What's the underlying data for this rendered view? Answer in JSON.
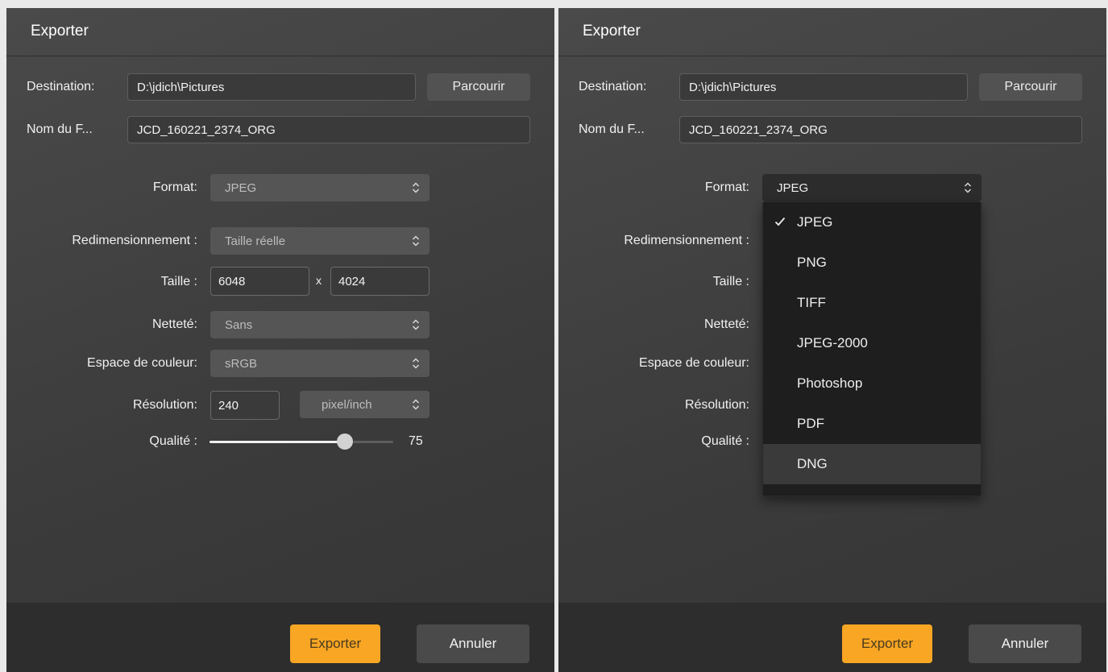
{
  "left_dialog": {
    "title": "Exporter",
    "destination_label": "Destination:",
    "destination_value": "D:\\jdich\\Pictures",
    "browse_label": "Parcourir",
    "filename_label": "Nom du F...",
    "filename_value": "JCD_160221_2374_ORG",
    "format_label": "Format:",
    "format_value": "JPEG",
    "resize_label": "Redimensionnement :",
    "resize_value": "Taille réelle",
    "size_label": "Taille :",
    "width_value": "6048",
    "times_sign": "x",
    "height_value": "4024",
    "sharpness_label": "Netteté:",
    "sharpness_value": "Sans",
    "colorspace_label": "Espace de couleur:",
    "colorspace_value": "sRGB",
    "resolution_label": "Résolution:",
    "resolution_value": "240",
    "resolution_unit": "pixel/inch",
    "quality_label": "Qualité :",
    "quality_value": "75",
    "quality_fraction": 0.75,
    "export_label": "Exporter",
    "cancel_label": "Annuler"
  },
  "right_dialog": {
    "title": "Exporter",
    "destination_label": "Destination:",
    "destination_value": "D:\\jdich\\Pictures",
    "browse_label": "Parcourir",
    "filename_label": "Nom du F...",
    "filename_value": "JCD_160221_2374_ORG",
    "format_label": "Format:",
    "format_value": "JPEG",
    "resize_label": "Redimensionnement :",
    "size_label": "Taille :",
    "sharpness_label": "Netteté:",
    "colorspace_label": "Espace de couleur:",
    "resolution_label": "Résolution:",
    "quality_label": "Qualité :",
    "format_menu": {
      "items": [
        "JPEG",
        "PNG",
        "TIFF",
        "JPEG-2000",
        "Photoshop",
        "PDF",
        "DNG"
      ],
      "selected": "JPEG",
      "hovered": "DNG"
    },
    "export_label": "Exporter",
    "cancel_label": "Annuler"
  },
  "colors": {
    "accent": "#f8a623",
    "dialog_bg": "#404040",
    "footer_bg": "#2d2d2d",
    "menu_bg": "#1e1e1e"
  },
  "icons": {
    "select_chevron": "chevron-up-down-icon",
    "menu_check": "check-icon"
  }
}
